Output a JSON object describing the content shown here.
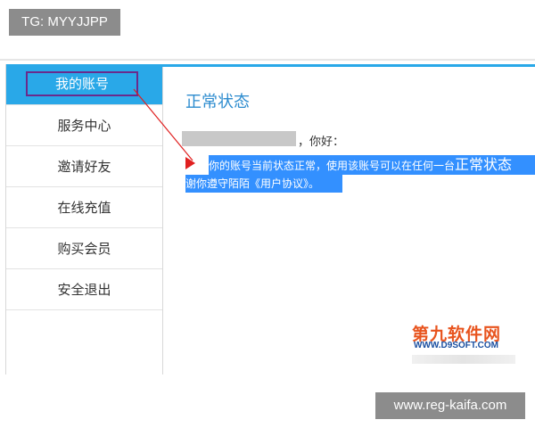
{
  "watermark_top": "TG: MYYJJPP",
  "watermark_bottom": "www.reg-kaifa.com",
  "sidebar": {
    "items": [
      {
        "label": "我的账号",
        "active": true
      },
      {
        "label": "服务中心"
      },
      {
        "label": "邀请好友"
      },
      {
        "label": "在线充值"
      },
      {
        "label": "购买会员"
      },
      {
        "label": "安全退出"
      }
    ]
  },
  "content": {
    "title": "正常状态",
    "greeting": "，你好：",
    "message_line1": "你的账号当前状态正常，使用该账号可以在任何一台",
    "message_line1_large": "正常状态",
    "message_line2": "谢你遵守陌陌《用户协议》。"
  },
  "logo": {
    "main": "第九软件网",
    "sub": "WWW.D9SOFT.COM"
  },
  "colors": {
    "accent_blue": "#29a8e8",
    "highlight_blue": "#3390ff",
    "title_blue": "#2d8ccf",
    "annotation_purple": "#6a2a8c",
    "annotation_red": "#e02020",
    "logo_orange": "#e8541e",
    "logo_blue": "#1a4fa0"
  }
}
